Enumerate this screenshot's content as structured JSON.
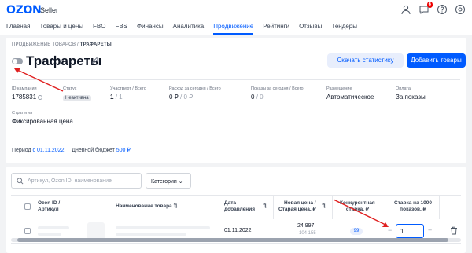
{
  "brand": {
    "logo": "OZON",
    "suffix": "Seller"
  },
  "header": {
    "messages_badge": "6"
  },
  "nav": {
    "items": [
      "Главная",
      "Товары и цены",
      "FBO",
      "FBS",
      "Финансы",
      "Аналитика",
      "Продвижение",
      "Рейтинги",
      "Отзывы",
      "Тендеры"
    ],
    "active": "Продвижение"
  },
  "breadcrumb": {
    "parent": "ПРОДВИЖЕНИЕ ТОВАРОВ",
    "sep": "/",
    "current": "ТРАФАРЕТЫ"
  },
  "page": {
    "title": "Трафареты",
    "download_button": "Скачать статистику",
    "add_button": "Добавить товары"
  },
  "stats": {
    "campaign_id": {
      "label": "ID кампании",
      "value": "1785831"
    },
    "status": {
      "label": "Статус",
      "value": "Неактивна"
    },
    "participate": {
      "label": "Участвуют / Всего",
      "value": "1",
      "total": "/ 1"
    },
    "spend": {
      "label": "Расход за сегодня / Всего",
      "value": "0 ₽",
      "total": "/ 0 ₽"
    },
    "views": {
      "label": "Показы за сегодня / Всего",
      "value": "0",
      "total": "/ 0"
    },
    "placement": {
      "label": "Размещение",
      "value": "Автоматическое"
    },
    "payment": {
      "label": "Оплата",
      "value": "За показы"
    },
    "strategy": {
      "label": "Стратегия",
      "value": "Фиксированная цена"
    }
  },
  "period": {
    "label": "Период",
    "value": "с 01.11.2022",
    "budget_label": "Дневной бюджет",
    "budget_value": "500 ₽"
  },
  "filters": {
    "search_placeholder": "Артикул, Ozon ID, наименование",
    "category": "Категории"
  },
  "table": {
    "headers": {
      "ozon_id": "Ozon ID /\nАртикул",
      "name": "Наименование товара ⇅",
      "date": "Дата\nдобавления",
      "date_sort": "⇅",
      "price": "Новая цена /\nСтарая цена, ₽",
      "price_sort": "⇅",
      "competitive": "Конкурентная\nставка, ₽",
      "bid": "Ставка на 1000\nпоказов, ₽"
    },
    "row": {
      "date": "01.11.2022",
      "new_price": "24 997",
      "old_price": "104 155",
      "competitive": "99",
      "bid": "1"
    }
  },
  "colors": {
    "accent": "#005bff",
    "annotation": "#e02020"
  }
}
